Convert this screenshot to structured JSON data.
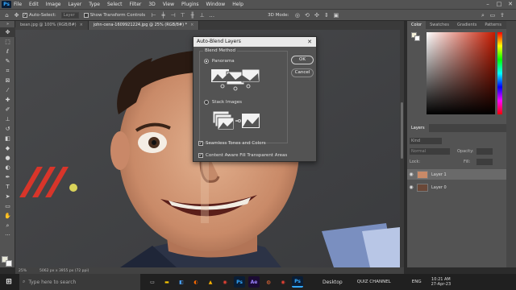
{
  "app": {
    "logo": "Ps"
  },
  "menu": [
    "File",
    "Edit",
    "Image",
    "Layer",
    "Type",
    "Select",
    "Filter",
    "3D",
    "View",
    "Plugins",
    "Window",
    "Help"
  ],
  "options_bar": {
    "auto_select_label": "Auto-Select:",
    "auto_select_value": "Layer",
    "show_transform_label": "Show Transform Controls",
    "mode_3d_label": "3D Mode:"
  },
  "tabs": [
    {
      "label": "bean.jpg @ 100% (RGB/8#)",
      "active": false
    },
    {
      "label": "john-cena-1609921224.jpg @ 25% (RGB/8#) *",
      "active": true
    }
  ],
  "dialog": {
    "title": "Auto-Blend Layers",
    "group_label": "Blend Method",
    "option_panorama": "Panorama",
    "option_stack": "Stack Images",
    "ok": "OK",
    "cancel": "Cancel",
    "seamless": "Seamless Tones and Colors",
    "content_aware": "Content Aware Fill Transparent Areas"
  },
  "right_panel": {
    "color_tabs": [
      "Color",
      "Swatches",
      "Gradients",
      "Patterns"
    ],
    "layers_tab": "Layers",
    "kind_label": "Kind",
    "blend_mode": "Normal",
    "opacity_label": "Opacity:",
    "lock_label": "Lock:",
    "fill_label": "Fill:",
    "layers": [
      {
        "name": "Layer 1"
      },
      {
        "name": "Layer 0"
      }
    ]
  },
  "status": {
    "zoom": "25%",
    "doc_info": "5062 px x 3955 px (72 ppi)"
  },
  "taskbar": {
    "search_placeholder": "Type here to search",
    "desktop_label": "Desktop",
    "quiz_label": "QUIZ CHANNEL",
    "lang": "ENG",
    "time": "10:21 AM",
    "date": "27-Apr-23"
  },
  "colors": {
    "ps_blue": "#31a8ff",
    "taskbar": "#202020",
    "ui_gray": "#535353"
  }
}
